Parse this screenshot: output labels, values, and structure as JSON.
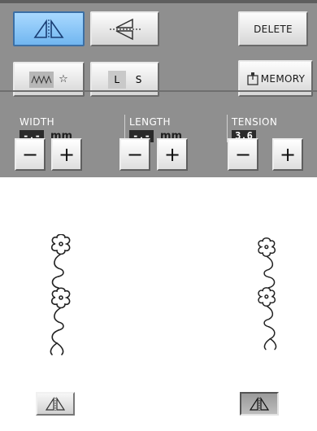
{
  "toolbar": {
    "mirror_horizontal_icon": "mirror-horizontal-icon",
    "mirror_vertical_icon": "mirror-vertical-icon",
    "delete_label": "DELETE",
    "memory_label": "MEMORY",
    "pattern_star": "☆",
    "ls_left": "L",
    "ls_right": "S"
  },
  "settings": {
    "width": {
      "label": "WIDTH",
      "value": "-.-",
      "unit": "mm"
    },
    "length": {
      "label": "LENGTH",
      "value": "-.-",
      "unit": "mm"
    },
    "tension": {
      "label": "TENSION",
      "value": "3.6"
    }
  },
  "steppers": {
    "minus": "−",
    "plus": "+"
  },
  "colors": {
    "panel": "#8f8f8f",
    "active_button": "#8ec8f8",
    "value_box": "#2a2a2a"
  },
  "bottom_keys": {
    "normal_icon": "mirror-key-icon",
    "pressed_icon": "mirror-key-pressed-icon"
  }
}
